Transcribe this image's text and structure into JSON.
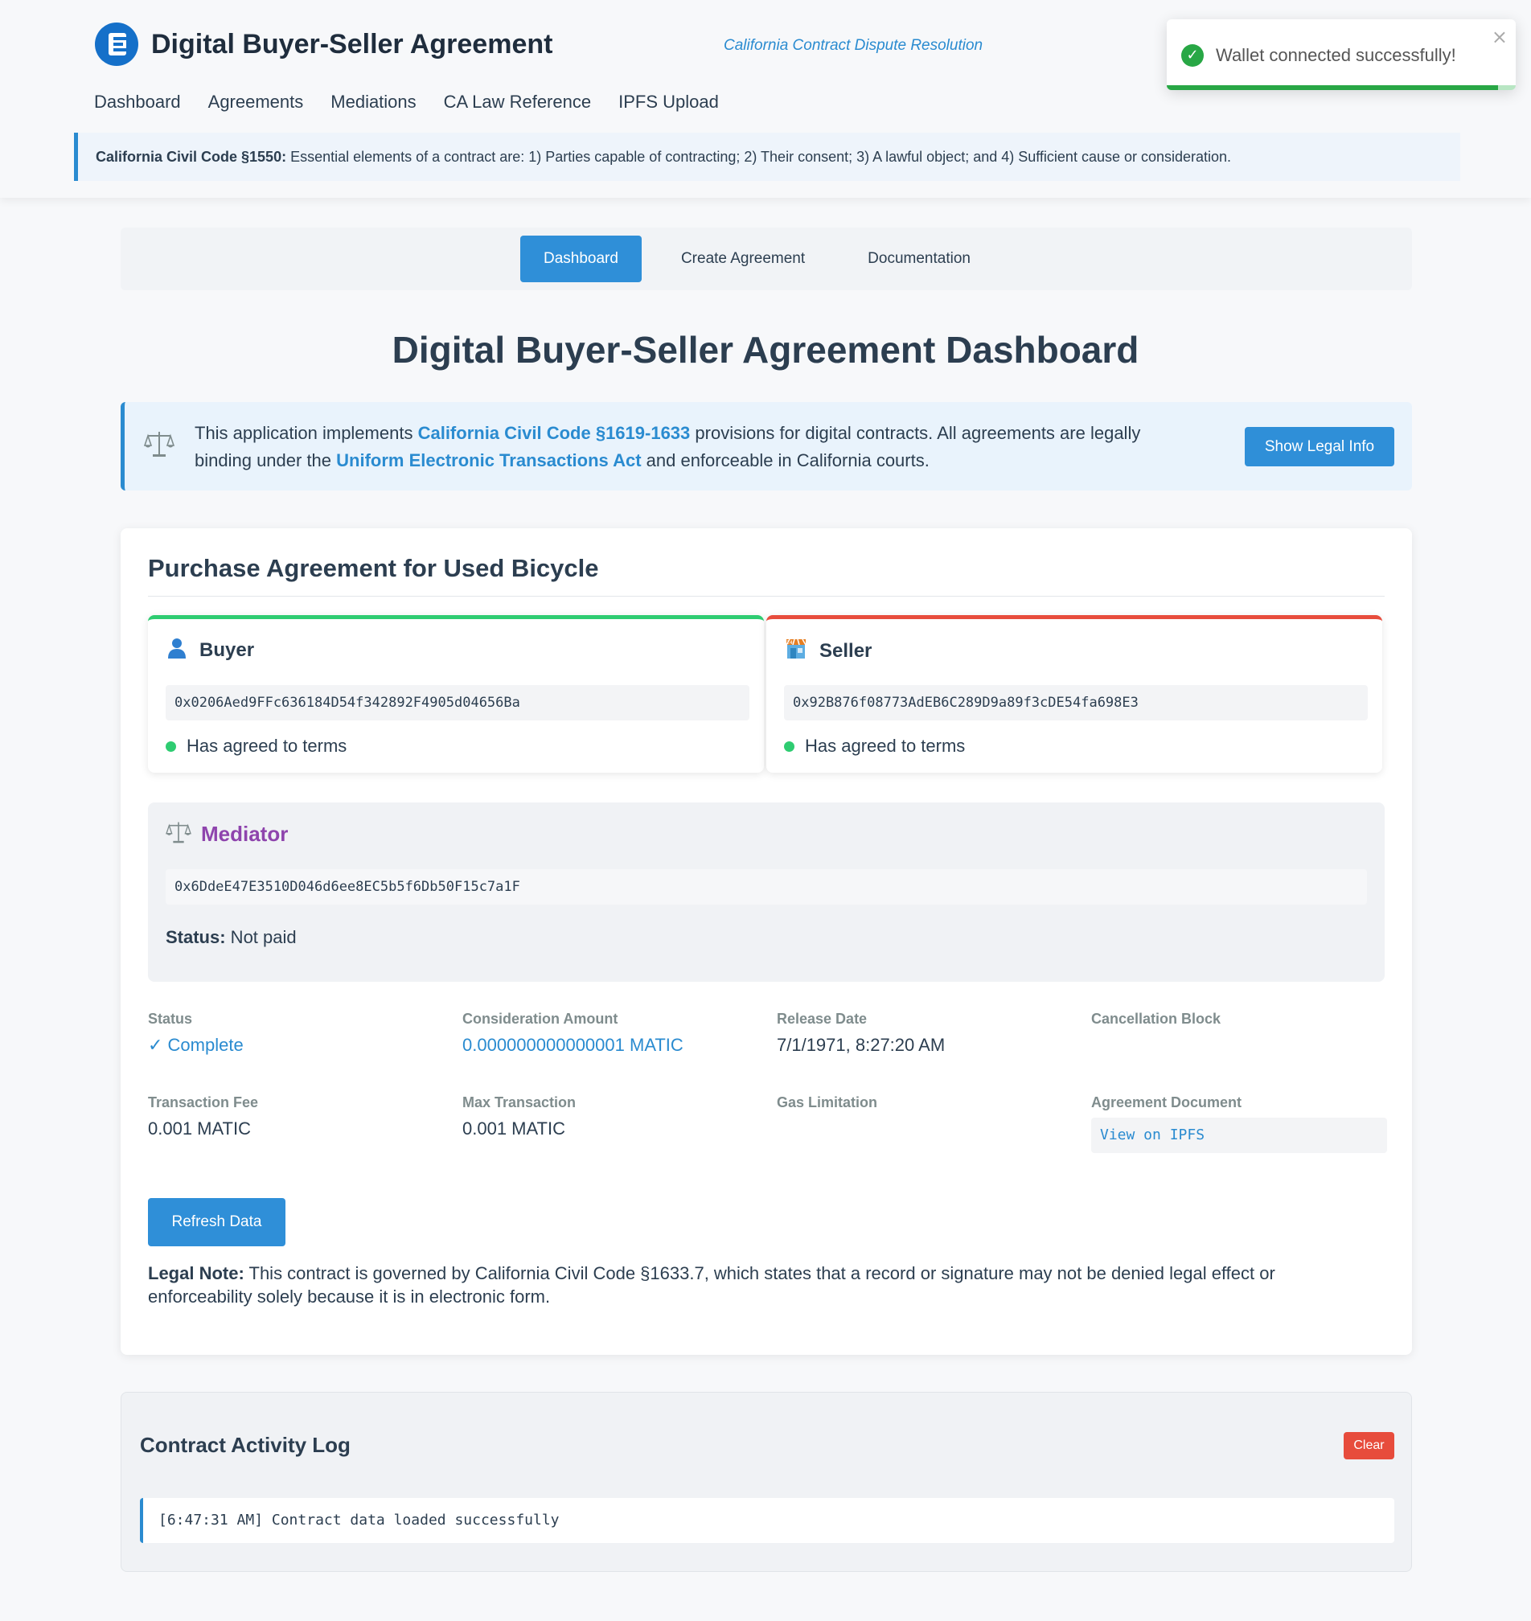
{
  "header": {
    "title": "Digital Buyer-Seller Agreement",
    "subtitle": "California Contract Dispute Resolution",
    "nav": [
      "Dashboard",
      "Agreements",
      "Mediations",
      "CA Law Reference",
      "IPFS Upload"
    ],
    "banner_label": "California Civil Code §1550:",
    "banner_text": " Essential elements of a contract are: 1) Parties capable of contracting; 2) Their consent; 3) A lawful object; and 4) Sufficient cause or consideration."
  },
  "toast": {
    "message": "Wallet connected successfully!",
    "close": "×",
    "progress": 0.95
  },
  "tabs": [
    "Dashboard",
    "Create Agreement",
    "Documentation"
  ],
  "page_title": "Digital Buyer-Seller Agreement Dashboard",
  "info": {
    "text_1": "This application implements ",
    "link_1": "California Civil Code §1619-1633",
    "text_2": " provisions for digital contracts. All agreements are legally binding under the ",
    "link_2": "Uniform Electronic Transactions Act",
    "text_3": " and enforceable in California courts.",
    "button": "Show Legal Info"
  },
  "agreement": {
    "title": "Purchase Agreement for Used Bicycle",
    "buyer": {
      "label": "Buyer",
      "icon": "person-icon",
      "address": "0x0206Aed9FFc636184D54f342892F4905d04656Ba",
      "status": "Has agreed to terms"
    },
    "seller": {
      "label": "Seller",
      "icon": "store-icon",
      "address": "0x92B876f08773AdEB6C289D9a89f3cDE54fa698E3",
      "status": "Has agreed to terms"
    },
    "mediator": {
      "label": "Mediator",
      "icon": "scale-icon",
      "address": "0x6DdeE47E3510D046d6ee8EC5b5f6Db50F15c7a1F",
      "status_label": "Status:",
      "status_value": " Not paid"
    },
    "details": {
      "status_label": "Status",
      "status_value": "✓ Complete",
      "consideration_label": "Consideration Amount",
      "consideration_value": "0.000000000000001 MATIC",
      "release_label": "Release Date",
      "release_value": "7/1/1971, 8:27:20 AM",
      "cancellation_label": "Cancellation Block",
      "cancellation_value": "",
      "fee_label": "Transaction Fee",
      "fee_value": "0.001 MATIC",
      "max_label": "Max Transaction",
      "max_value": "0.001 MATIC",
      "gas_label": "Gas Limitation",
      "gas_value": "",
      "document_label": "Agreement Document",
      "document_link": "View on IPFS"
    },
    "refresh_button": "Refresh Data",
    "legal_note_label": "Legal Note:",
    "legal_note_text": " This contract is governed by California Civil Code §1633.7, which states that a record or signature may not be denied legal effect or enforceability solely because it is in electronic form."
  },
  "log": {
    "title": "Contract Activity Log",
    "clear": "Clear",
    "entries": [
      "[6:47:31 AM] Contract data loaded successfully"
    ]
  },
  "colors": {
    "primary": "#2f8fd8",
    "buyer_accent": "#2ecc71",
    "seller_accent": "#e74c3c",
    "mediator": "#8e44ad",
    "success": "#28a745"
  }
}
